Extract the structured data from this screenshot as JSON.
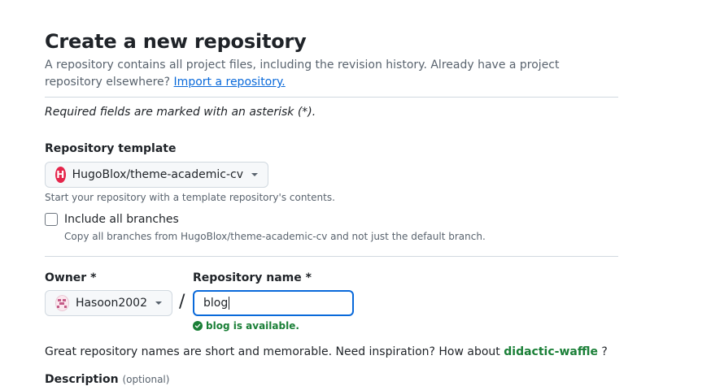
{
  "page": {
    "title": "Create a new repository",
    "lede": "A repository contains all project files, including the revision history. Already have a project repository elsewhere?",
    "import_link": "Import a repository.",
    "required_note": "Required fields are marked with an asterisk (*)."
  },
  "template": {
    "label": "Repository template",
    "selected": "HugoBlox/theme-academic-cv",
    "hint": "Start your repository with a template repository's contents."
  },
  "branches": {
    "label": "Include all branches",
    "hint": "Copy all branches from HugoBlox/theme-academic-cv and not just the default branch.",
    "checked": false
  },
  "owner": {
    "label": "Owner *",
    "selected": "Hasoon2002"
  },
  "separator": "/",
  "repo_name": {
    "label": "Repository name *",
    "value": "blog",
    "availability": "blog is available."
  },
  "inspiration": {
    "text": "Great repository names are short and memorable. Need inspiration? How about",
    "suggestion": "didactic-waffle",
    "suffix": "?"
  },
  "description": {
    "label": "Description",
    "optional": "(optional)"
  },
  "colors": {
    "link": "#0969da",
    "success": "#1a7f37",
    "focus": "#0969da",
    "muted": "#59636e"
  },
  "icons": {
    "template_logo": "hugoblox-logo-icon",
    "owner_avatar": "user-avatar-icon",
    "dropdown": "triangle-down-icon",
    "available": "check-circle-fill-icon"
  }
}
